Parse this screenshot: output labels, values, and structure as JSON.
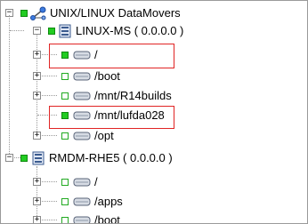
{
  "tree": {
    "root": {
      "label": "UNIX/LINUX DataMovers",
      "expander": "−"
    },
    "hosts": [
      {
        "label": "LINUX-MS ( 0.0.0.0 )",
        "expander": "−",
        "children": [
          {
            "label": "/",
            "expander": "+",
            "status": "on"
          },
          {
            "label": "/boot",
            "expander": "+",
            "status": "off"
          },
          {
            "label": "/mnt/R14builds",
            "expander": "+",
            "status": "off"
          },
          {
            "label": "/mnt/lufda028",
            "expander": "",
            "status": "on"
          },
          {
            "label": "/opt",
            "expander": "+",
            "status": "off"
          }
        ]
      },
      {
        "label": "RMDM-RHE5 ( 0.0.0.0 )",
        "expander": "−",
        "children": [
          {
            "label": "/",
            "expander": "+",
            "status": "off"
          },
          {
            "label": "/apps",
            "expander": "+",
            "status": "off"
          },
          {
            "label": "/boot",
            "expander": "+",
            "status": "off"
          }
        ]
      }
    ]
  },
  "colors": {
    "status_on": "#22cc22",
    "status_off": "#ffffff",
    "highlight": "#e02424"
  }
}
